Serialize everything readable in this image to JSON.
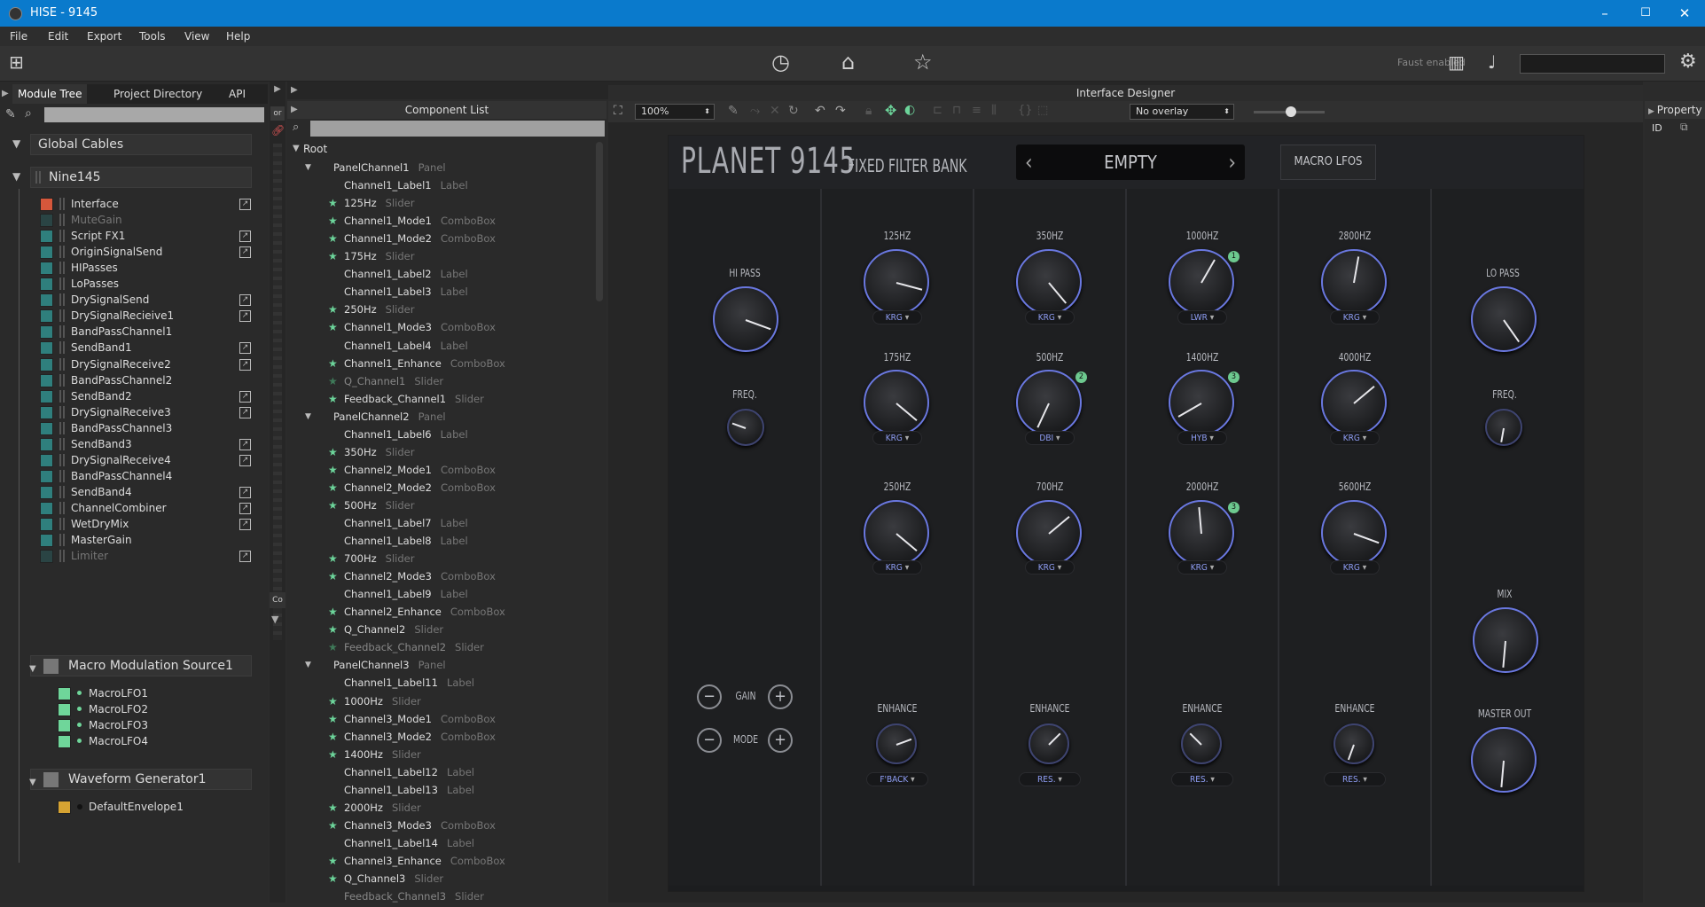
{
  "window": {
    "title": "HISE - 9145",
    "min": "–",
    "max": "☐",
    "close": "✕"
  },
  "menu": [
    "File",
    "Edit",
    "Export",
    "Tools",
    "View",
    "Help"
  ],
  "toolbar": {
    "faust": "Faust enabled"
  },
  "left": {
    "tabs": [
      "Module Tree",
      "Project Directory",
      "API"
    ],
    "global_cables": "Global Cables",
    "root_module": "Nine145",
    "modules": [
      {
        "name": "Interface",
        "color": "#d5573b",
        "link": true,
        "dim": false
      },
      {
        "name": "MuteGain",
        "color": "#2f7f7d",
        "link": false,
        "dim": true
      },
      {
        "name": "Script FX1",
        "color": "#2f7f7d",
        "link": true,
        "dim": false
      },
      {
        "name": "OriginSignalSend",
        "color": "#2f7f7d",
        "link": true,
        "dim": false
      },
      {
        "name": "HIPasses",
        "color": "#2f7f7d",
        "link": false,
        "dim": false
      },
      {
        "name": "LoPasses",
        "color": "#2f7f7d",
        "link": false,
        "dim": false
      },
      {
        "name": "DrySignalSend",
        "color": "#2f7f7d",
        "link": true,
        "dim": false
      },
      {
        "name": "DrySignalRecieive1",
        "color": "#2f7f7d",
        "link": true,
        "dim": false
      },
      {
        "name": "BandPassChannel1",
        "color": "#2f7f7d",
        "link": false,
        "dim": false
      },
      {
        "name": "SendBand1",
        "color": "#2f7f7d",
        "link": true,
        "dim": false
      },
      {
        "name": "DrySignalReceive2",
        "color": "#2f7f7d",
        "link": true,
        "dim": false
      },
      {
        "name": "BandPassChannel2",
        "color": "#2f7f7d",
        "link": false,
        "dim": false
      },
      {
        "name": "SendBand2",
        "color": "#2f7f7d",
        "link": true,
        "dim": false
      },
      {
        "name": "DrySignalReceive3",
        "color": "#2f7f7d",
        "link": true,
        "dim": false
      },
      {
        "name": "BandPassChannel3",
        "color": "#2f7f7d",
        "link": false,
        "dim": false
      },
      {
        "name": "SendBand3",
        "color": "#2f7f7d",
        "link": true,
        "dim": false
      },
      {
        "name": "DrySignalReceive4",
        "color": "#2f7f7d",
        "link": true,
        "dim": false
      },
      {
        "name": "BandPassChannel4",
        "color": "#2f7f7d",
        "link": false,
        "dim": false
      },
      {
        "name": "SendBand4",
        "color": "#2f7f7d",
        "link": true,
        "dim": false
      },
      {
        "name": "ChannelCombiner",
        "color": "#2f7f7d",
        "link": true,
        "dim": false
      },
      {
        "name": "WetDryMix",
        "color": "#2f7f7d",
        "link": true,
        "dim": false
      },
      {
        "name": "MasterGain",
        "color": "#2f7f7d",
        "link": false,
        "dim": false
      },
      {
        "name": "Limiter",
        "color": "#2f7f7d",
        "link": true,
        "dim": true
      }
    ],
    "macro_source": "Macro Modulation Source1",
    "lfos": [
      "MacroLFO1",
      "MacroLFO2",
      "MacroLFO3",
      "MacroLFO4"
    ],
    "waveform": "Waveform Generator1",
    "envelope": "DefaultEnvelope1"
  },
  "vstrip": {
    "tab1": "or",
    "tab2": "Co"
  },
  "component_list": {
    "title": "Component List",
    "root": "Root",
    "rows": [
      {
        "name": "PanelChannel1",
        "type": "Panel",
        "indent": 0,
        "star": false,
        "panel": true
      },
      {
        "name": "Channel1_Label1",
        "type": "Label",
        "indent": 1,
        "star": false
      },
      {
        "name": "125Hz",
        "type": "Slider",
        "indent": 1,
        "star": true
      },
      {
        "name": "Channel1_Mode1",
        "type": "ComboBox",
        "indent": 1,
        "star": true
      },
      {
        "name": "Channel1_Mode2",
        "type": "ComboBox",
        "indent": 1,
        "star": true
      },
      {
        "name": "175Hz",
        "type": "Slider",
        "indent": 1,
        "star": true
      },
      {
        "name": "Channel1_Label2",
        "type": "Label",
        "indent": 1,
        "star": false
      },
      {
        "name": "Channel1_Label3",
        "type": "Label",
        "indent": 1,
        "star": false
      },
      {
        "name": "250Hz",
        "type": "Slider",
        "indent": 1,
        "star": true
      },
      {
        "name": "Channel1_Mode3",
        "type": "ComboBox",
        "indent": 1,
        "star": true
      },
      {
        "name": "Channel1_Label4",
        "type": "Label",
        "indent": 1,
        "star": false
      },
      {
        "name": "Channel1_Enhance",
        "type": "ComboBox",
        "indent": 1,
        "star": true
      },
      {
        "name": "Q_Channel1",
        "type": "Slider",
        "indent": 1,
        "star": true,
        "dim": true
      },
      {
        "name": "Feedback_Channel1",
        "type": "Slider",
        "indent": 1,
        "star": true
      },
      {
        "name": "PanelChannel2",
        "type": "Panel",
        "indent": 0,
        "star": false,
        "panel": true
      },
      {
        "name": "Channel1_Label6",
        "type": "Label",
        "indent": 1,
        "star": false
      },
      {
        "name": "350Hz",
        "type": "Slider",
        "indent": 1,
        "star": true
      },
      {
        "name": "Channel2_Mode1",
        "type": "ComboBox",
        "indent": 1,
        "star": true
      },
      {
        "name": "Channel2_Mode2",
        "type": "ComboBox",
        "indent": 1,
        "star": true
      },
      {
        "name": "500Hz",
        "type": "Slider",
        "indent": 1,
        "star": true
      },
      {
        "name": "Channel1_Label7",
        "type": "Label",
        "indent": 1,
        "star": false
      },
      {
        "name": "Channel1_Label8",
        "type": "Label",
        "indent": 1,
        "star": false
      },
      {
        "name": "700Hz",
        "type": "Slider",
        "indent": 1,
        "star": true
      },
      {
        "name": "Channel2_Mode3",
        "type": "ComboBox",
        "indent": 1,
        "star": true
      },
      {
        "name": "Channel1_Label9",
        "type": "Label",
        "indent": 1,
        "star": false
      },
      {
        "name": "Channel2_Enhance",
        "type": "ComboBox",
        "indent": 1,
        "star": true
      },
      {
        "name": "Q_Channel2",
        "type": "Slider",
        "indent": 1,
        "star": true
      },
      {
        "name": "Feedback_Channel2",
        "type": "Slider",
        "indent": 1,
        "star": true,
        "dim": true
      },
      {
        "name": "PanelChannel3",
        "type": "Panel",
        "indent": 0,
        "star": false,
        "panel": true
      },
      {
        "name": "Channel1_Label11",
        "type": "Label",
        "indent": 1,
        "star": false
      },
      {
        "name": "1000Hz",
        "type": "Slider",
        "indent": 1,
        "star": true
      },
      {
        "name": "Channel3_Mode1",
        "type": "ComboBox",
        "indent": 1,
        "star": true
      },
      {
        "name": "Channel3_Mode2",
        "type": "ComboBox",
        "indent": 1,
        "star": true
      },
      {
        "name": "1400Hz",
        "type": "Slider",
        "indent": 1,
        "star": true
      },
      {
        "name": "Channel1_Label12",
        "type": "Label",
        "indent": 1,
        "star": false
      },
      {
        "name": "Channel1_Label13",
        "type": "Label",
        "indent": 1,
        "star": false
      },
      {
        "name": "2000Hz",
        "type": "Slider",
        "indent": 1,
        "star": true
      },
      {
        "name": "Channel3_Mode3",
        "type": "ComboBox",
        "indent": 1,
        "star": true
      },
      {
        "name": "Channel1_Label14",
        "type": "Label",
        "indent": 1,
        "star": false
      },
      {
        "name": "Channel3_Enhance",
        "type": "ComboBox",
        "indent": 1,
        "star": true
      },
      {
        "name": "Q_Channel3",
        "type": "Slider",
        "indent": 1,
        "star": true
      },
      {
        "name": "Feedback_Channel3",
        "type": "Slider",
        "indent": 1,
        "star": false,
        "dim": true
      }
    ]
  },
  "designer": {
    "title": "Interface Designer",
    "zoom": "100%",
    "overlay": "No overlay"
  },
  "property": {
    "title": "Property",
    "id": "ID"
  },
  "plugin": {
    "brand": "PLANET 9145",
    "subtitle": "FIXED FILTER BANK",
    "preset": "EMPTY",
    "prev": "‹",
    "next": "›",
    "macro_button": "MACRO LFOS",
    "hipass": "HI PASS",
    "lopass": "LO PASS",
    "freq": "FREQ.",
    "gain": "GAIN",
    "mode": "MODE",
    "mix": "MIX",
    "master": "MASTER OUT",
    "minus": "−",
    "plus": "+",
    "columns": [
      {
        "bands": [
          {
            "label": "125HZ",
            "mode": "KRG",
            "badge": ""
          },
          {
            "label": "175HZ",
            "mode": "KRG",
            "badge": ""
          },
          {
            "label": "250HZ",
            "mode": "KRG",
            "badge": ""
          }
        ],
        "enhance": "ENHANCE",
        "enhance_mode": "F'BACK"
      },
      {
        "bands": [
          {
            "label": "350HZ",
            "mode": "KRG",
            "badge": ""
          },
          {
            "label": "500HZ",
            "mode": "DBI",
            "badge": "2"
          },
          {
            "label": "700HZ",
            "mode": "KRG",
            "badge": ""
          }
        ],
        "enhance": "ENHANCE",
        "enhance_mode": "RES."
      },
      {
        "bands": [
          {
            "label": "1000HZ",
            "mode": "LWR",
            "badge": "1"
          },
          {
            "label": "1400HZ",
            "mode": "HYB",
            "badge": "3"
          },
          {
            "label": "2000HZ",
            "mode": "KRG",
            "badge": "3"
          }
        ],
        "enhance": "ENHANCE",
        "enhance_mode": "RES."
      },
      {
        "bands": [
          {
            "label": "2800HZ",
            "mode": "KRG",
            "badge": ""
          },
          {
            "label": "4000HZ",
            "mode": "KRG",
            "badge": ""
          },
          {
            "label": "5600HZ",
            "mode": "KRG",
            "badge": ""
          }
        ],
        "enhance": "ENHANCE",
        "enhance_mode": "RES."
      }
    ]
  }
}
